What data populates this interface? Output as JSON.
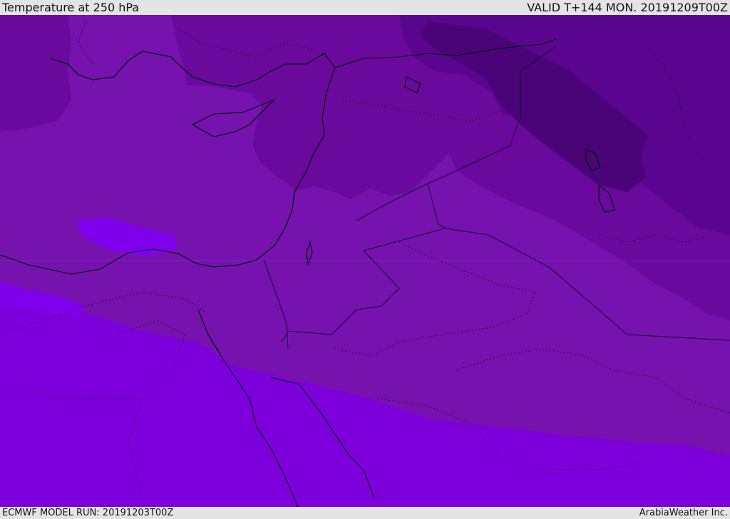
{
  "header": {
    "title": "Temperature at 250 hPa",
    "valid": "VALID T+144 MON. 20191209T00Z"
  },
  "footer": {
    "model_run": "ECMWF MODEL RUN: 20191203T00Z",
    "credit": "ArabiaWeather Inc."
  },
  "map": {
    "field": "temperature-250hPa",
    "colors": {
      "coldest": "#4a0478",
      "colder": "#5a0590",
      "cold": "#6a0a9c",
      "mid": "#7612ae",
      "warm": "#7f18c4",
      "warmest": "#7d00dc",
      "pocket": "#8000ee",
      "coast": "#000000",
      "border": "#1a0030"
    }
  }
}
